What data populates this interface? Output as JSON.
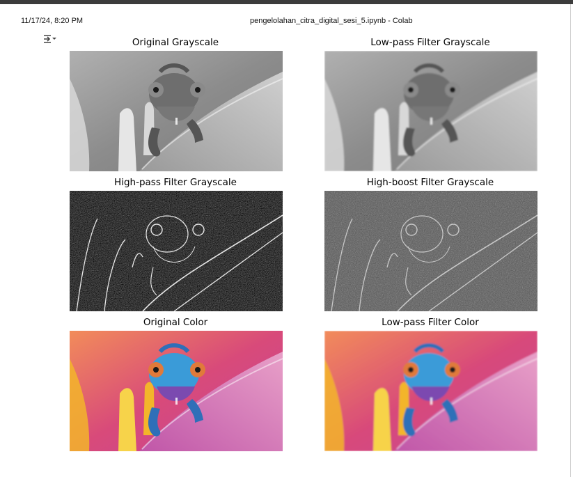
{
  "header": {
    "datetime": "11/17/24, 8:20 PM",
    "document_title": "pengelolahan_citra_digital_sesi_5.ipynb - Colab"
  },
  "output_toggle": {
    "icon": "output-collapse-icon"
  },
  "figure": {
    "panels": [
      {
        "title": "Original Grayscale",
        "kind": "gray"
      },
      {
        "title": "Low-pass Filter Grayscale",
        "kind": "gray-blur"
      },
      {
        "title": "High-pass Filter Grayscale",
        "kind": "highpass"
      },
      {
        "title": "High-boost Filter Grayscale",
        "kind": "highboost"
      },
      {
        "title": "Original Color",
        "kind": "color"
      },
      {
        "title": "Low-pass Filter Color",
        "kind": "color-blur"
      }
    ]
  }
}
